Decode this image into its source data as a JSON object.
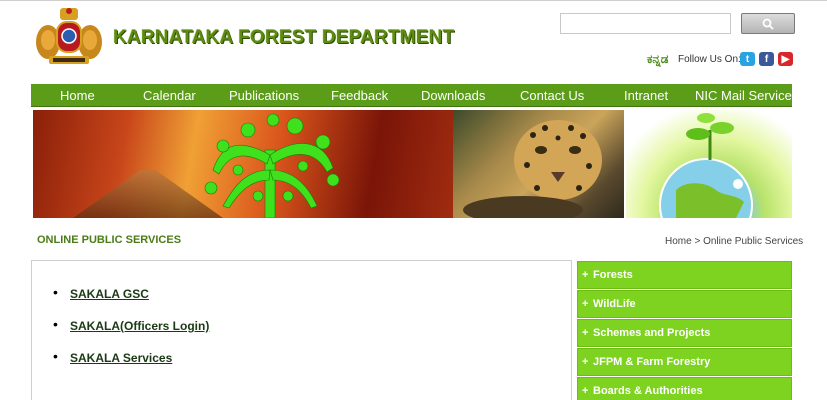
{
  "header": {
    "title": "KARNATAKA FOREST DEPARTMENT",
    "search": {
      "value": "",
      "placeholder": ""
    },
    "language_link": "ಕನ್ನಡ",
    "follow_label": "Follow Us On:",
    "social": [
      {
        "name": "twitter",
        "glyph": "t"
      },
      {
        "name": "facebook",
        "glyph": "f"
      },
      {
        "name": "youtube",
        "glyph": "▶"
      }
    ]
  },
  "nav": {
    "items": [
      {
        "label": "Home"
      },
      {
        "label": "Calendar"
      },
      {
        "label": "Publications"
      },
      {
        "label": "Feedback"
      },
      {
        "label": "Downloads"
      },
      {
        "label": "Contact Us"
      },
      {
        "label": "Intranet"
      },
      {
        "label": "NIC Mail Service"
      }
    ]
  },
  "section": {
    "title": "ONLINE PUBLIC SERVICES",
    "breadcrumb": {
      "home": "Home",
      "separator": " > ",
      "current": "Online Public Services"
    }
  },
  "services": [
    {
      "label": "SAKALA GSC"
    },
    {
      "label": "SAKALA(Officers Login)"
    },
    {
      "label": "SAKALA Services"
    }
  ],
  "side_menu": [
    {
      "plus": "+",
      "label": "Forests"
    },
    {
      "plus": "+",
      "label": "WildLife"
    },
    {
      "plus": "+",
      "label": "Schemes and Projects"
    },
    {
      "plus": "+",
      "label": "JFPM & Farm Forestry"
    },
    {
      "plus": "+",
      "label": "Boards & Authorities"
    }
  ],
  "colors": {
    "brand_green": "#5b9c19",
    "menu_green": "#7ed321",
    "title_green": "#5e8c12"
  }
}
